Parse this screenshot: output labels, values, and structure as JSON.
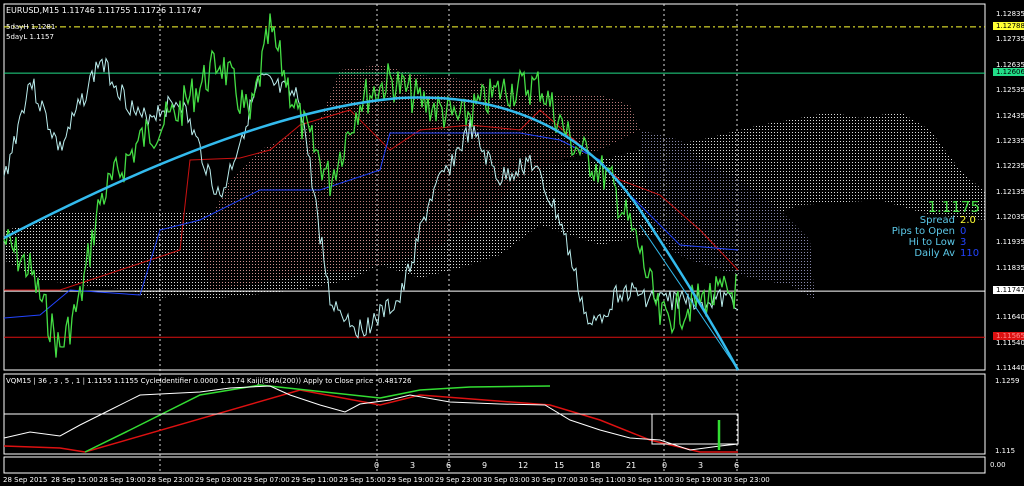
{
  "header": {
    "symbol_line": "EURUSD,M15  1.11746 1.11755 1.11726 1.11747",
    "five_day_high": "5dayH 1.1281",
    "five_day_low": "5dayL 1.1157"
  },
  "price_axis": {
    "ticks": [
      "1.12835",
      "1.12735",
      "1.12635",
      "1.12535",
      "1.12435",
      "1.12335",
      "1.12235",
      "1.12135",
      "1.12035",
      "1.11935",
      "1.11835",
      "1.11640",
      "1.11540",
      "1.11440"
    ],
    "tick_values": [
      1.12835,
      1.12735,
      1.12635,
      1.12535,
      1.12435,
      1.12335,
      1.12235,
      1.12135,
      1.12035,
      1.11935,
      1.11835,
      1.1164,
      1.1154,
      1.1144
    ],
    "markers": [
      {
        "label": "1.12788",
        "value": 1.12788,
        "color": "#ffff33",
        "text_color": "#000000"
      },
      {
        "label": "1.12606",
        "value": 1.12606,
        "color": "#22dd88",
        "text_color": "#000000"
      },
      {
        "label": "1.11747",
        "value": 1.11747,
        "color": "#ffffff",
        "text_color": "#000000"
      },
      {
        "label": "1.11565",
        "value": 1.11565,
        "color": "#dd1111",
        "text_color": "#ff8888"
      }
    ]
  },
  "info_panel": {
    "price": "1.1175",
    "rows": [
      {
        "label": "Spread",
        "value": "2.0",
        "color": "#ffff33"
      },
      {
        "label": "Pips to Open",
        "value": "0",
        "color": "#2244ff"
      },
      {
        "label": "Hi to Low",
        "value": "3",
        "color": "#2244ff"
      },
      {
        "label": "Daily Av",
        "value": "110",
        "color": "#2244ff"
      }
    ]
  },
  "indicator": {
    "label": "VQM15 | 36 , 3 , 5 , 1  |  1.1155 1.1155  CycleIdentifier 0.0000 1.1174  Kaiji(SMA(200)) Apply to Close price -0.481726",
    "axis_top": "1.1259",
    "axis_bottom": "1.115",
    "axis_zero": "0.00"
  },
  "hour_strip": [
    "0",
    "3",
    "6",
    "9",
    "12",
    "15",
    "18",
    "21",
    "0",
    "3",
    "6"
  ],
  "time_axis": [
    "28 Sep 2015",
    "28 Sep 15:00",
    "28 Sep 19:00",
    "28 Sep 23:00",
    "29 Sep 03:00",
    "29 Sep 07:00",
    "29 Sep 11:00",
    "29 Sep 15:00",
    "29 Sep 19:00",
    "29 Sep 23:00",
    "30 Sep 03:00",
    "30 Sep 07:00",
    "30 Sep 11:00",
    "30 Sep 15:00",
    "30 Sep 19:00",
    "30 Sep 23:00"
  ],
  "colors": {
    "ma": "#33bbee",
    "price": "#44dd44",
    "kijun": "#cc1111",
    "tenkan": "#2244ff",
    "chikou": "#bbeeee"
  }
}
